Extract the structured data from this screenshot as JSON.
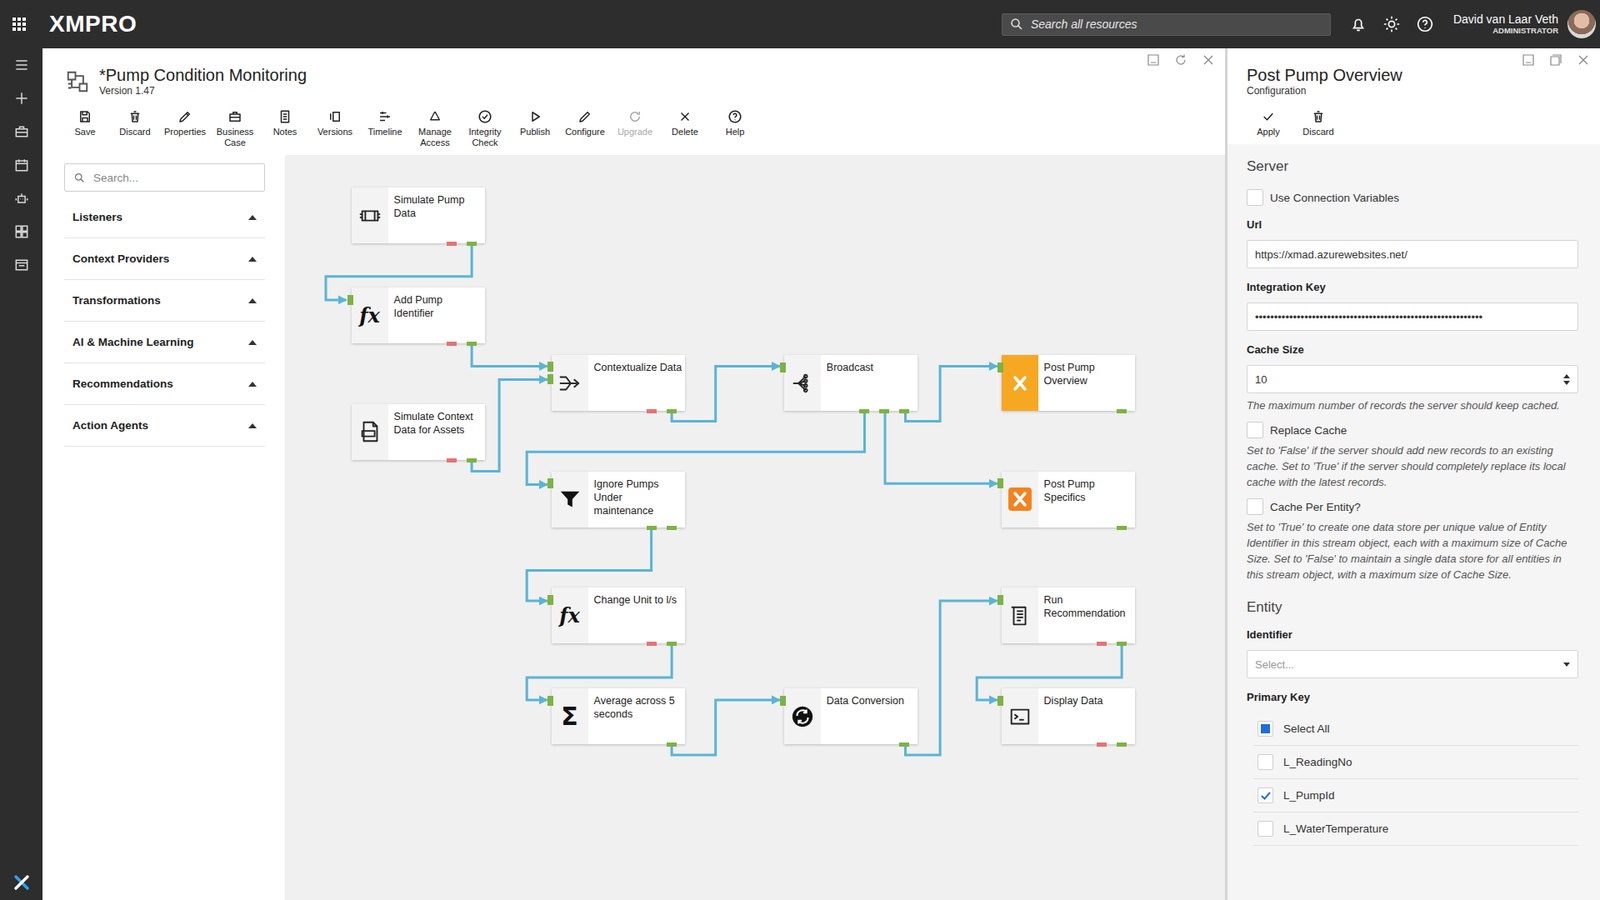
{
  "topbar": {
    "brand": "XMPRO",
    "search_placeholder": "Search all resources",
    "user_name": "David van Laar Veth",
    "user_role": "ADMINISTRATOR"
  },
  "editor": {
    "title": "*Pump Condition Monitoring",
    "version": "Version 1.47",
    "toolbar": [
      {
        "label": "Save",
        "disabled": false
      },
      {
        "label": "Discard",
        "disabled": false
      },
      {
        "label": "Properties",
        "disabled": false
      },
      {
        "label": "Business Case",
        "disabled": false
      },
      {
        "label": "Notes",
        "disabled": false
      },
      {
        "label": "Versions",
        "disabled": false
      },
      {
        "label": "Timeline",
        "disabled": false
      },
      {
        "label": "Manage Access",
        "disabled": false
      },
      {
        "label": "Integrity Check",
        "disabled": false
      },
      {
        "label": "Publish",
        "disabled": false
      },
      {
        "label": "Configure",
        "disabled": false
      },
      {
        "label": "Upgrade",
        "disabled": true
      },
      {
        "label": "Delete",
        "disabled": false
      },
      {
        "label": "Help",
        "disabled": false
      }
    ],
    "palette": {
      "search_placeholder": "Search...",
      "categories": [
        {
          "label": "Listeners",
          "expanded": false
        },
        {
          "label": "Context Providers",
          "expanded": false
        },
        {
          "label": "Transformations",
          "expanded": false
        },
        {
          "label": "AI & Machine Learning",
          "expanded": false
        },
        {
          "label": "Recommendations",
          "expanded": false
        },
        {
          "label": "Action Agents",
          "expanded": false
        }
      ]
    },
    "nodes": [
      {
        "label": "Simulate Pump Data",
        "selected": false,
        "inputs": 0,
        "outputs": 1,
        "error_port": true
      },
      {
        "label": "Add Pump Identifier",
        "glyph": "fx",
        "selected": false,
        "inputs": 1,
        "outputs": 1,
        "error_port": true
      },
      {
        "label": "Simulate Context Data for Assets",
        "selected": false,
        "inputs": 0,
        "outputs": 1,
        "error_port": true
      },
      {
        "label": "Contextualize Data",
        "selected": false,
        "inputs": 2,
        "outputs": 1,
        "error_port": true
      },
      {
        "label": "Broadcast",
        "selected": false,
        "inputs": 1,
        "outputs": 3,
        "error_port": false
      },
      {
        "label": "Post Pump Overview",
        "selected": true,
        "inputs": 1,
        "outputs": 1,
        "error_port": false
      },
      {
        "label": "Post Pump Specifics",
        "selected": false,
        "inputs": 1,
        "outputs": 1,
        "error_port": false
      },
      {
        "label": "Ignore Pumps Under maintenance",
        "selected": false,
        "inputs": 1,
        "outputs": 2,
        "error_port": false
      },
      {
        "label": "Change Unit to l/s",
        "glyph": "fx",
        "selected": false,
        "inputs": 1,
        "outputs": 1,
        "error_port": true
      },
      {
        "label": "Average across 5 seconds",
        "glyph": "Σ",
        "selected": false,
        "inputs": 1,
        "outputs": 1,
        "error_port": false
      },
      {
        "label": "Data Conversion",
        "selected": false,
        "inputs": 1,
        "outputs": 1,
        "error_port": false
      },
      {
        "label": "Run Recommendation",
        "selected": false,
        "inputs": 1,
        "outputs": 1,
        "error_port": true
      },
      {
        "label": "Display Data",
        "selected": false,
        "inputs": 1,
        "outputs": 1,
        "error_port": true
      }
    ]
  },
  "config_panel": {
    "title": "Post Pump Overview",
    "subtitle": "Configuration",
    "toolbar": [
      {
        "label": "Apply"
      },
      {
        "label": "Discard"
      }
    ],
    "sections": [
      {
        "heading": "Server",
        "fields": [
          {
            "kind": "checkbox",
            "label": "Use Connection Variables",
            "checked": false
          },
          {
            "kind": "input",
            "label": "Url",
            "value": "https://xmad.azurewebsites.net/"
          },
          {
            "kind": "input",
            "label": "Integration Key",
            "value": "••••••••••••••••••••••••••••••••••••••••••••••••••••••••••••"
          },
          {
            "kind": "number",
            "label": "Cache Size",
            "value": "10",
            "help": "The maximum number of records the server should keep cached."
          },
          {
            "kind": "checkbox",
            "label": "Replace Cache",
            "checked": false,
            "help": "Set to 'False' if the server should add new records to an existing cache. Set to 'True' if the server should completely replace its local cache with the latest records."
          },
          {
            "kind": "checkbox",
            "label": "Cache Per Entity?",
            "checked": false,
            "help": "Set to 'True' to create one data store per unique value of Entity Identifier in this stream object, each with a maximum size of Cache Size. Set to 'False' to maintain a single data store for all entities in this stream object, with a maximum size of Cache Size."
          }
        ]
      },
      {
        "heading": "Entity",
        "fields": [
          {
            "kind": "select",
            "label": "Identifier",
            "placeholder": "Select..."
          },
          {
            "kind": "checklist",
            "label": "Primary Key",
            "options": [
              {
                "label": "Select All",
                "checked": false,
                "partial": true
              },
              {
                "label": "L_ReadingNo",
                "checked": false,
                "partial": false
              },
              {
                "label": "L_PumpId",
                "checked": true,
                "partial": false
              },
              {
                "label": "L_WaterTemperature",
                "checked": false,
                "partial": false
              }
            ]
          }
        ]
      }
    ]
  }
}
